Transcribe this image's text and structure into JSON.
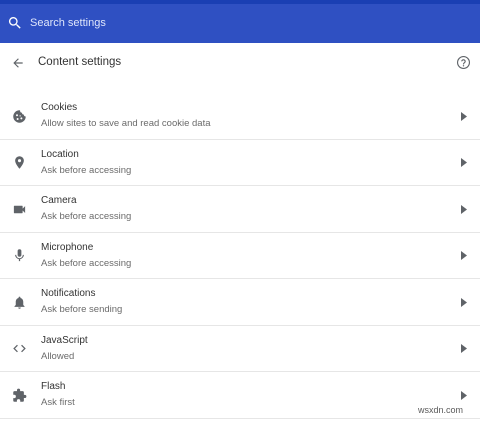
{
  "search": {
    "placeholder": "Search settings",
    "icon": "search-icon"
  },
  "header": {
    "title": "Content settings",
    "back_icon": "arrow-back-icon",
    "help_icon": "help-icon"
  },
  "colors": {
    "search_bar": "#2f50c2",
    "top_strip": "#1a3fb3",
    "icon": "#5f6368",
    "divider": "#e6e6e6"
  },
  "items": [
    {
      "title": "Cookies",
      "subtitle": "Allow sites to save and read cookie data",
      "icon": "cookie-icon"
    },
    {
      "title": "Location",
      "subtitle": "Ask before accessing",
      "icon": "location-pin-icon"
    },
    {
      "title": "Camera",
      "subtitle": "Ask before accessing",
      "icon": "video-camera-icon"
    },
    {
      "title": "Microphone",
      "subtitle": "Ask before accessing",
      "icon": "microphone-icon"
    },
    {
      "title": "Notifications",
      "subtitle": "Ask before sending",
      "icon": "bell-icon"
    },
    {
      "title": "JavaScript",
      "subtitle": "Allowed",
      "icon": "code-brackets-icon"
    },
    {
      "title": "Flash",
      "subtitle": "Ask first",
      "icon": "puzzle-piece-icon"
    }
  ],
  "watermark": "wsxdn.com"
}
